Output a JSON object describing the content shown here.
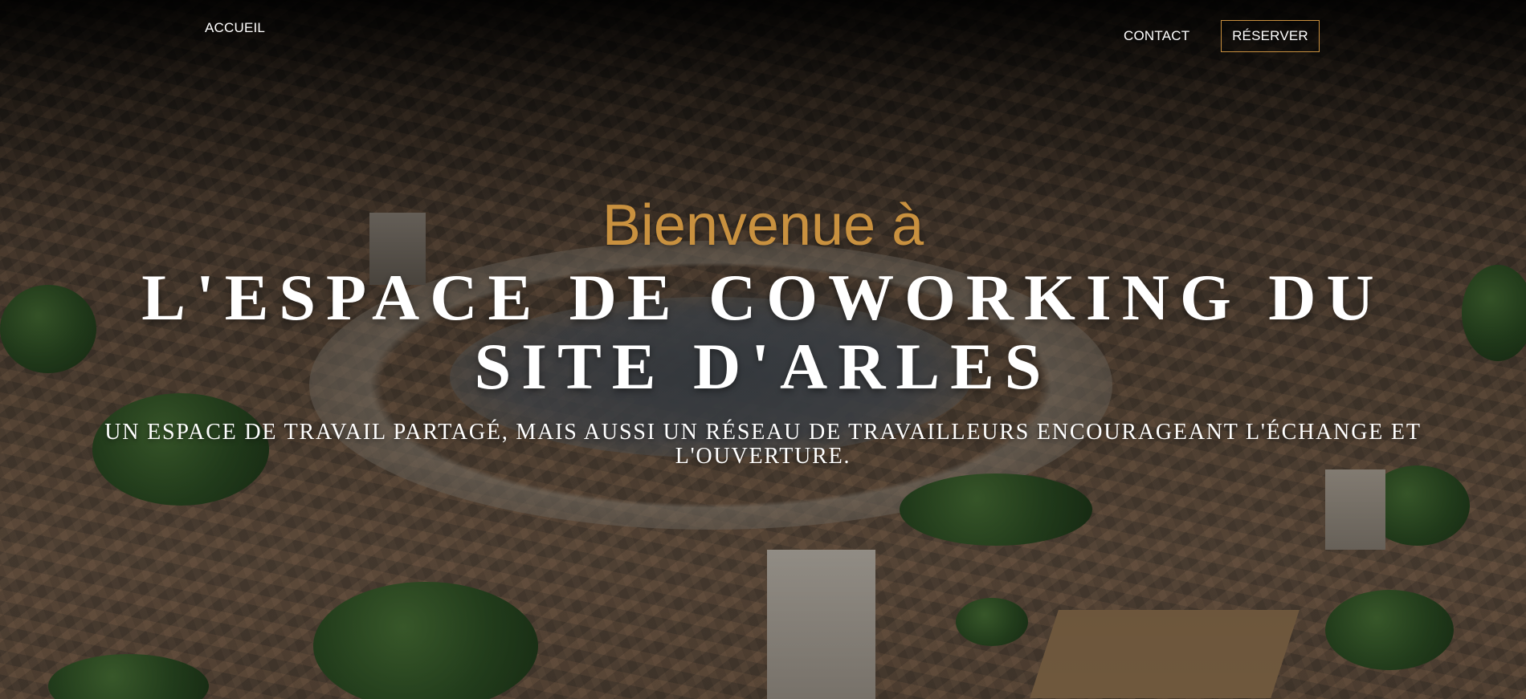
{
  "nav": {
    "home_label": "ACCUEIL",
    "contact_label": "CONTACT",
    "reserve_label": "RÉSERVER"
  },
  "hero": {
    "welcome": "Bienvenue à",
    "title": "L'ESPACE DE COWORKING DU SITE D'ARLES",
    "subtitle": "UN ESPACE DE TRAVAIL PARTAGÉ, MAIS AUSSI UN RÉSEAU DE TRAVAILLEURS ENCOURAGEANT L'ÉCHANGE ET L'OUVERTURE."
  },
  "colors": {
    "accent": "#c9913f",
    "text": "#ffffff",
    "button_border": "#c9903f"
  }
}
